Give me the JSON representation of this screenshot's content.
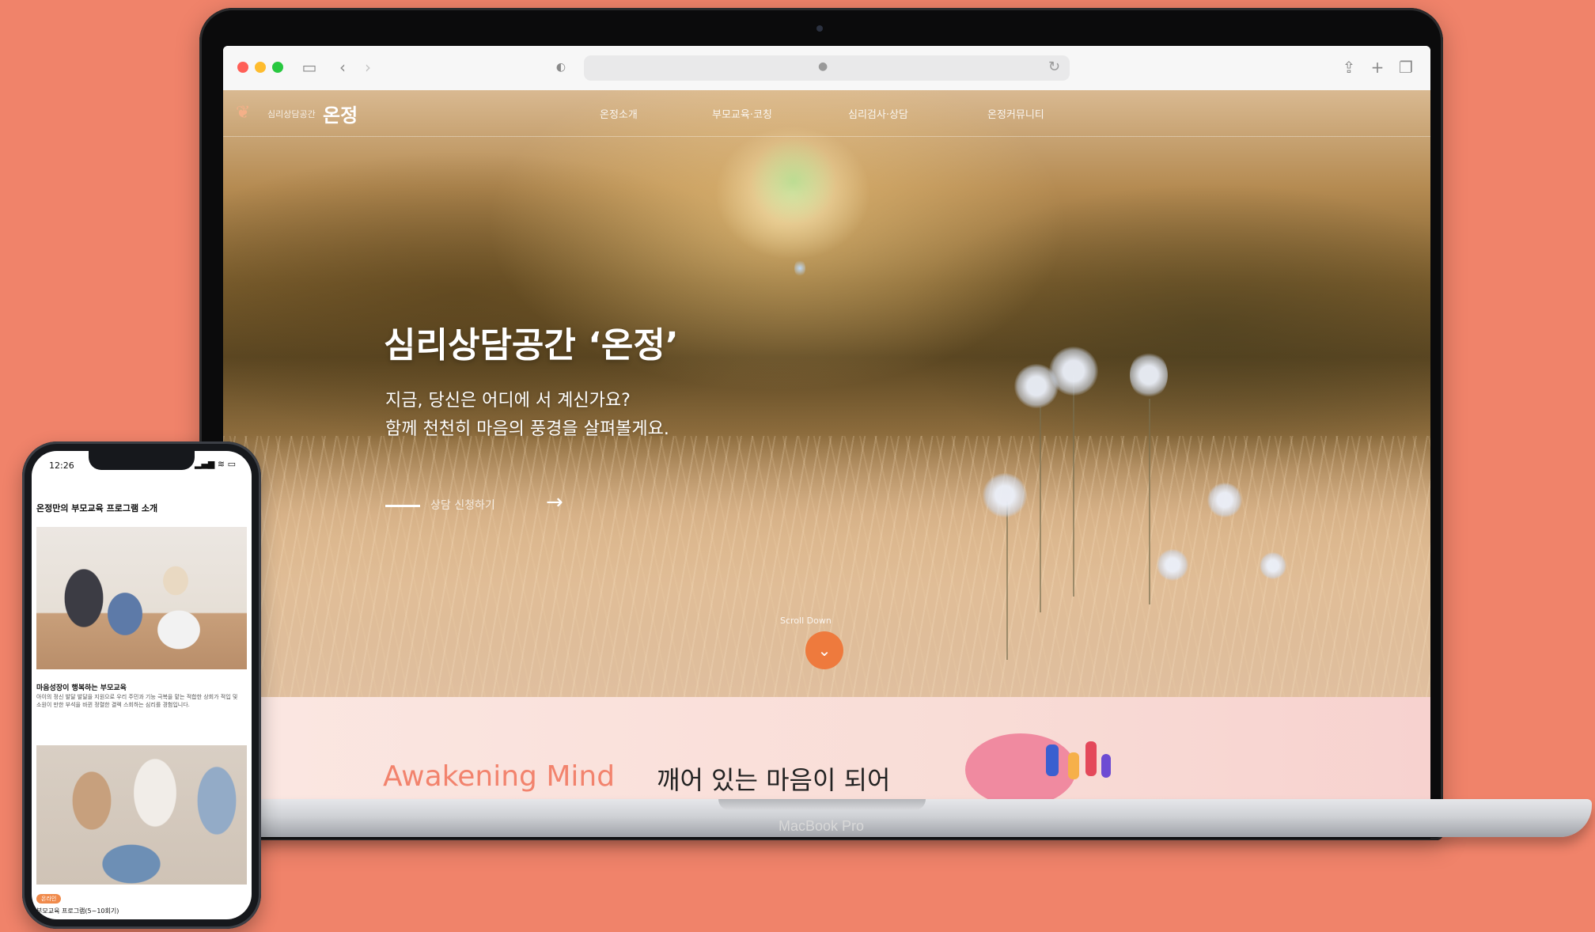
{
  "browser": {
    "toolbar_icons": [
      "sidebar-icon",
      "back-icon",
      "forward-icon",
      "privacy-icon",
      "lock-icon",
      "reload-icon",
      "share-icon",
      "new-tab-icon",
      "tabs-icon"
    ],
    "traffic_colors": [
      "#ff5f57",
      "#febc2e",
      "#28c840"
    ]
  },
  "site": {
    "logo_small": "심리상담공간",
    "logo_name": "온정",
    "nav": [
      "온정소개",
      "부모교육·코칭",
      "심리검사·상담",
      "온정커뮤니티"
    ],
    "hero": {
      "title": "심리상담공간 ‘온정’",
      "line1": "지금, 당신은 어디에 서 계신가요?",
      "line2": "함께 천천히 마음의 풍경을 살펴볼게요.",
      "cta_label": "상담 신청하기",
      "scroll_label": "Scroll Down"
    },
    "band": {
      "english": "Awakening Mind",
      "korean": "깨어 있는 마음이 되어"
    }
  },
  "laptop": {
    "model": "MacBook Pro"
  },
  "phone": {
    "time": "12:26",
    "status": "▂▄▆ ≋ ▭",
    "heading": "온정만의 부모교육 프로그램 소개",
    "card1_title": "마음성장이 행복하는 부모교육",
    "card1_text": "아이의 정신 발달 발달을 지원으로 우리 주민과 기능 극복을 맡는 적합한 상회가 적입 및 소원이 만한 부석을 바뀐 정렬한 결렉 스회하는 심리를 경험입니다.",
    "badge": "온라인",
    "card2_title": "부모교육 프로그램(5~10회기)"
  },
  "colors": {
    "background": "#f0836a",
    "accent": "#ee7a3d",
    "band_english": "#f2836d"
  }
}
